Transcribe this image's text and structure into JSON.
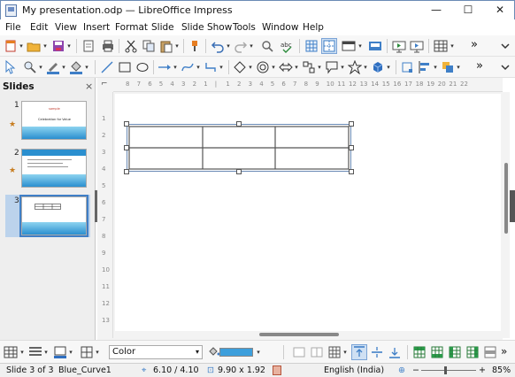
{
  "window": {
    "title": "My presentation.odp — LibreOffice Impress",
    "minimize": "—",
    "maximize": "☐",
    "close": "✕"
  },
  "menubar": {
    "items": [
      "File",
      "Edit",
      "View",
      "Insert",
      "Format",
      "Slide",
      "Slide Show",
      "Tools",
      "Window",
      "Help"
    ]
  },
  "toolbar": {
    "overflow": "»"
  },
  "slides_pane": {
    "title": "Slides",
    "close": "×",
    "slides": [
      {
        "number": "1",
        "title_text": "sample",
        "subtitle_text": "Celebration for Value"
      },
      {
        "number": "2"
      },
      {
        "number": "3"
      }
    ],
    "selected": 3
  },
  "ruler": {
    "h_ticks": [
      "8",
      "7",
      "6",
      "5",
      "4",
      "3",
      "2",
      "1",
      "",
      "1",
      "2",
      "3",
      "4",
      "5",
      "6",
      "7",
      "8",
      "9",
      "10",
      "11",
      "12",
      "13",
      "14",
      "15",
      "16",
      "17",
      "18",
      "19",
      "20",
      "21",
      "22"
    ],
    "v_ticks": [
      "1",
      "2",
      "3",
      "4",
      "5",
      "6",
      "7",
      "8",
      "9",
      "10",
      "11",
      "12",
      "13"
    ]
  },
  "table_toolbar": {
    "fill_mode": "Color",
    "fill_color": "#3d9fdc"
  },
  "status": {
    "slide_position": "Slide 3 of 3",
    "master": "Blue_Curve1",
    "cursor_position": "6.10 / 4.10",
    "object_size": "9.90 x 1.92",
    "language": "English (India)",
    "zoom": "85%"
  },
  "colors": {
    "accent": "#3f7fc7",
    "table_border": "#555555",
    "handle_border": "#6a8ab5"
  }
}
